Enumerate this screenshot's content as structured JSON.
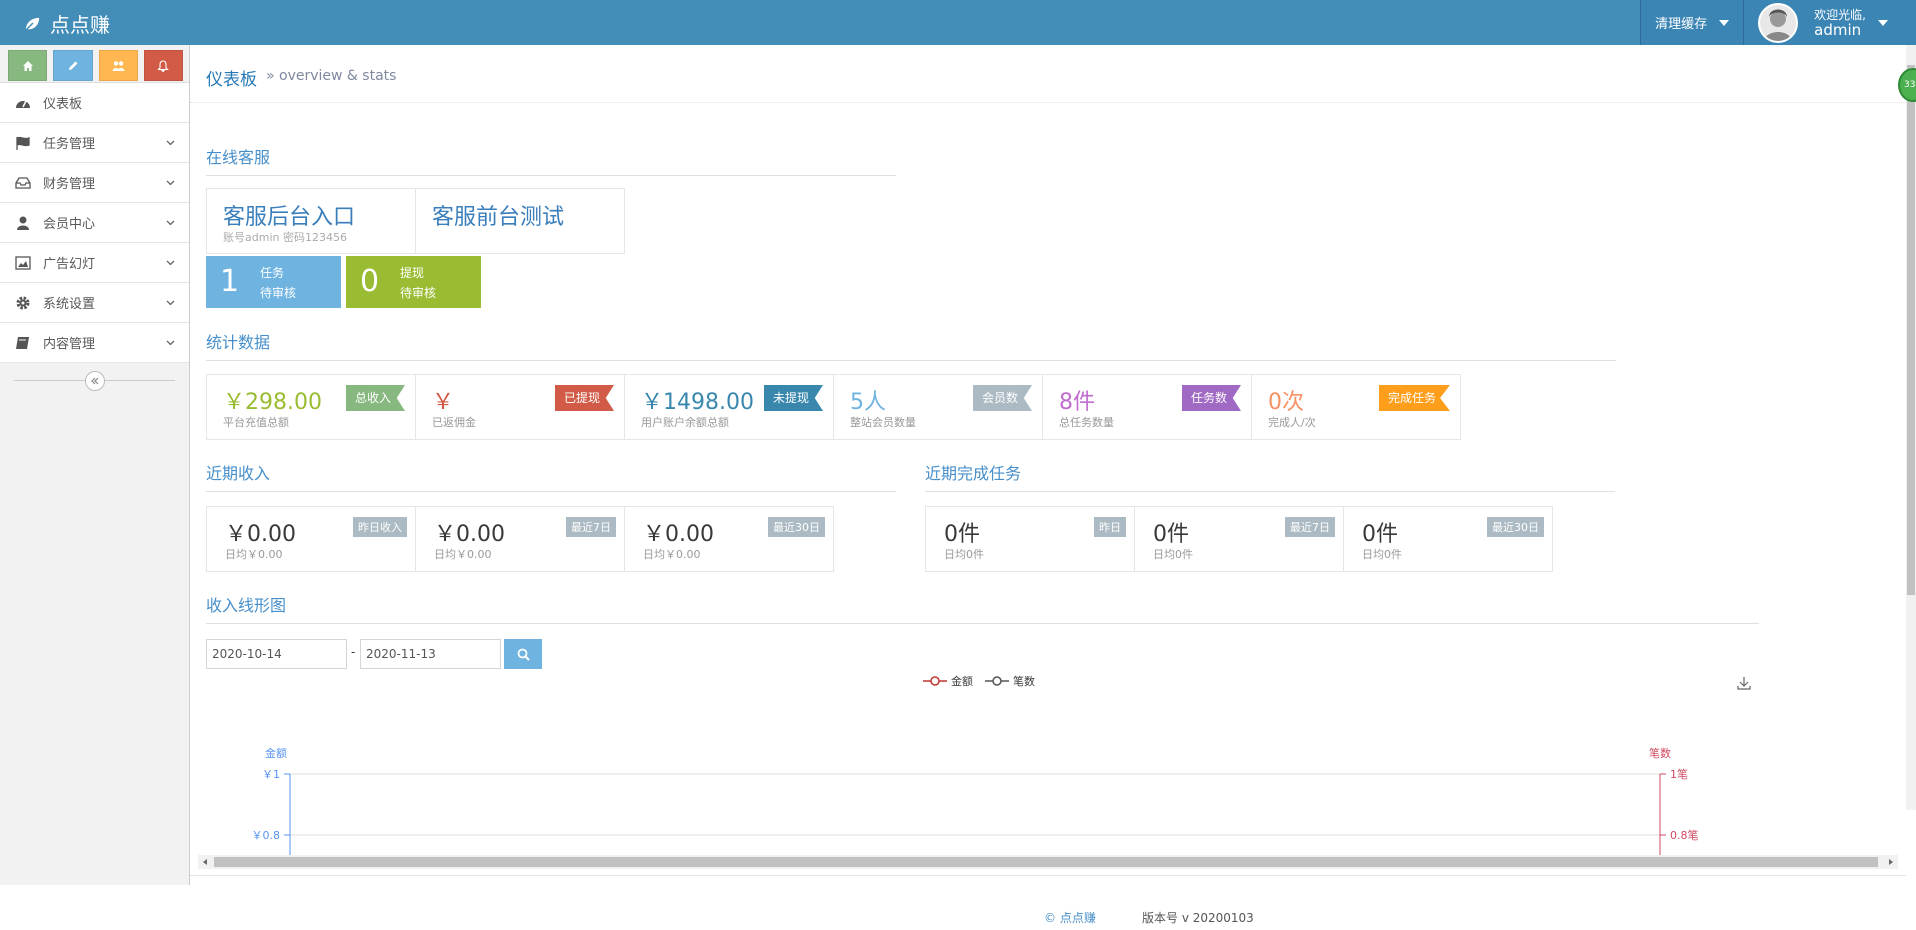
{
  "brand": {
    "name": "点点赚"
  },
  "header": {
    "clear_cache": "清理缓存",
    "welcome": "欢迎光临,",
    "username": "admin"
  },
  "sidebar": {
    "shortcut_colors": [
      "#87b87f",
      "#6fb3e0",
      "#ffb752",
      "#d15b47"
    ],
    "items": [
      {
        "label": "仪表板",
        "icon": "dashboard-icon"
      },
      {
        "label": "任务管理",
        "icon": "flag-icon"
      },
      {
        "label": "财务管理",
        "icon": "inbox-icon"
      },
      {
        "label": "会员中心",
        "icon": "user-icon"
      },
      {
        "label": "广告幻灯",
        "icon": "picture-icon"
      },
      {
        "label": "系统设置",
        "icon": "gear-icon"
      },
      {
        "label": "内容管理",
        "icon": "book-icon"
      }
    ]
  },
  "breadcrumb": {
    "title": "仪表板",
    "subtitle": "» overview & stats"
  },
  "sections": {
    "online_service": "在线客服",
    "stats": "统计数据",
    "recent_income": "近期收入",
    "recent_tasks": "近期完成任务",
    "income_chart": "收入线形图"
  },
  "kefu": [
    {
      "title": "客服后台入口",
      "note": "账号admin 密码123456"
    },
    {
      "title": "客服前台测试",
      "note": ""
    }
  ],
  "tiles": [
    {
      "num": "1",
      "line1": "任务",
      "line2": "待审核",
      "color": "#6fb3e0"
    },
    {
      "num": "0",
      "line1": "提现",
      "line2": "待审核",
      "color": "#9abc32"
    }
  ],
  "stats": [
    {
      "value": "￥298.00",
      "desc": "平台充值总额",
      "tag": "总收入",
      "value_color": "#9abc32",
      "tag_color": "#87b87f"
    },
    {
      "value": "￥",
      "desc": "已返佣金",
      "tag": "已提现",
      "value_color": "#d15b47",
      "tag_color": "#d15b47"
    },
    {
      "value": "￥1498.00",
      "desc": "用户账户余额总额",
      "tag": "未提现",
      "value_color": "#3a87ad",
      "tag_color": "#3a87ad"
    },
    {
      "value": "5人",
      "desc": "整站会员数量",
      "tag": "会员数",
      "value_color": "#6fb3e0",
      "tag_color": "#abbac3"
    },
    {
      "value": "8件",
      "desc": "总任务数量",
      "tag": "任务数",
      "value_color": "#c06bcf",
      "tag_color": "#a069c3"
    },
    {
      "value": "0次",
      "desc": "完成人/次",
      "tag": "完成任务",
      "value_color": "#f79263",
      "tag_color": "#ff9e1b"
    }
  ],
  "recent_income": [
    {
      "value": "￥0.00",
      "desc": "日均￥0.00",
      "tag": "昨日收入"
    },
    {
      "value": "￥0.00",
      "desc": "日均￥0.00",
      "tag": "最近7日"
    },
    {
      "value": "￥0.00",
      "desc": "日均￥0.00",
      "tag": "最近30日"
    }
  ],
  "recent_tasks": [
    {
      "value": "0件",
      "desc": "日均0件",
      "tag": "昨日"
    },
    {
      "value": "0件",
      "desc": "日均0件",
      "tag": "最近7日"
    },
    {
      "value": "0件",
      "desc": "日均0件",
      "tag": "最近30日"
    }
  ],
  "filter": {
    "start": "2020-10-14",
    "end": "2020-11-13",
    "sep": "-"
  },
  "chart": {
    "legend": [
      {
        "name": "金额",
        "color": "#c23531"
      },
      {
        "name": "笔数",
        "color": "#555555"
      }
    ],
    "left_axis_name": "金额",
    "right_axis_name": "笔数",
    "left_ticks": [
      "￥1",
      "￥0.8"
    ],
    "right_ticks": [
      "1笔",
      "0.8笔"
    ],
    "left_color": "#5793f3",
    "right_color": "#d14a61"
  },
  "footer": {
    "copyright": "© 点点赚",
    "version": "版本号 v 20200103"
  },
  "badge": {
    "text": "33"
  }
}
